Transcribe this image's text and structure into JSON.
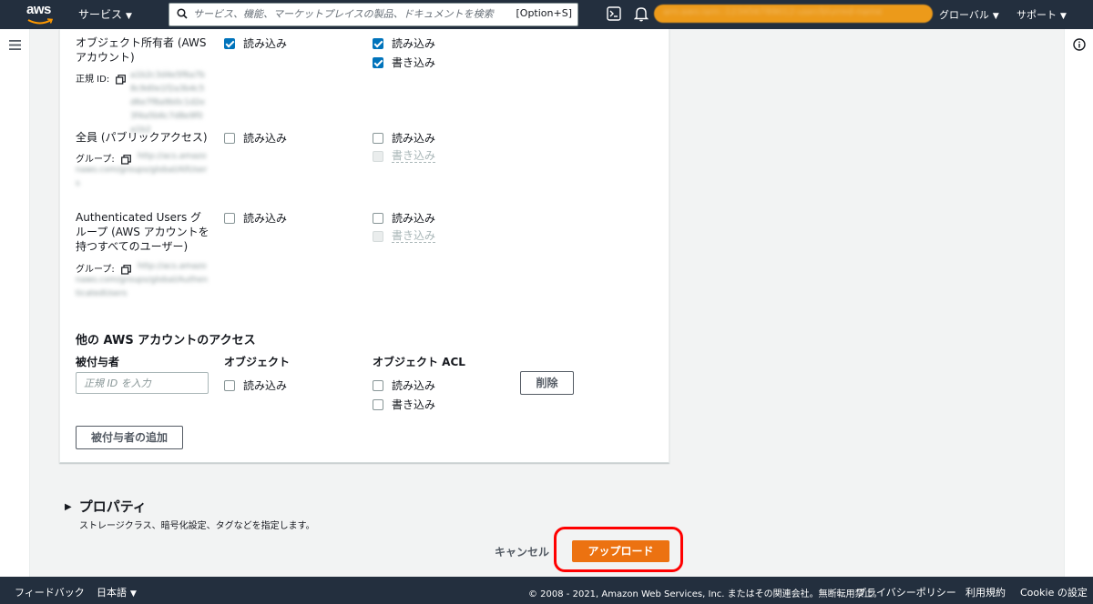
{
  "header": {
    "logo_text": "aws",
    "services_label": "サービス",
    "search_placeholder": "サービス、機能、マーケットプレイスの製品、ドキュメントを検索",
    "search_shortcut": "[Option+S]",
    "account_text": "arn:aws:iam::123456789012:user/blurred-name",
    "region_label": "グローバル",
    "support_label": "サポート",
    "accent_color": "#ec7211"
  },
  "acl": {
    "rows": [
      {
        "label": "オブジェクト所有者 (AWS アカウント)",
        "id_label": "正規 ID:",
        "id_value": "a1b2c3d4e5f6a7b8c9d0e1f2a3b4c5d6e7f8a9b0c1d2e3f4a5b6c7d8e9f0a1b2",
        "object_read": {
          "label": "読み込み",
          "checked": true
        },
        "acl_read": {
          "label": "読み込み",
          "checked": true
        },
        "acl_write": {
          "label": "書き込み",
          "checked": true
        }
      },
      {
        "label": "全員 (パブリックアクセス)",
        "id_label": "グループ:",
        "id_value": "http://acs.amazonaws.com/groups/global/AllUsers",
        "object_read": {
          "label": "読み込み",
          "checked": false
        },
        "acl_read": {
          "label": "読み込み",
          "checked": false
        },
        "acl_write": {
          "label": "書き込み",
          "checked": false,
          "disabled": true
        }
      },
      {
        "label": "Authenticated Users グループ (AWS アカウントを持つすべてのユーザー)",
        "id_label": "グループ:",
        "id_value": "http://acs.amazonaws.com/groups/global/AuthenticatedUsers",
        "object_read": {
          "label": "読み込み",
          "checked": false
        },
        "acl_read": {
          "label": "読み込み",
          "checked": false
        },
        "acl_write": {
          "label": "書き込み",
          "checked": false,
          "disabled": true
        }
      }
    ],
    "other_accounts": {
      "title": "他の AWS アカウントのアクセス",
      "col_grantee": "被付与者",
      "col_object": "オブジェクト",
      "col_object_acl": "オブジェクト ACL",
      "grantee_placeholder": "正規 ID を入力",
      "object_read_label": "読み込み",
      "acl_read_label": "読み込み",
      "acl_write_label": "書き込み",
      "remove_label": "削除",
      "add_grantee_label": "被付与者の追加"
    }
  },
  "properties": {
    "title": "プロパティ",
    "description": "ストレージクラス、暗号化設定、タグなどを指定します。"
  },
  "actions": {
    "cancel_label": "キャンセル",
    "upload_label": "アップロード"
  },
  "footer": {
    "feedback": "フィードバック",
    "language": "日本語",
    "copyright": "© 2008 - 2021, Amazon Web Services, Inc. またはその関連会社。無断転用禁止。",
    "privacy": "プライバシーポリシー",
    "terms": "利用規約",
    "cookie": "Cookie の設定"
  }
}
